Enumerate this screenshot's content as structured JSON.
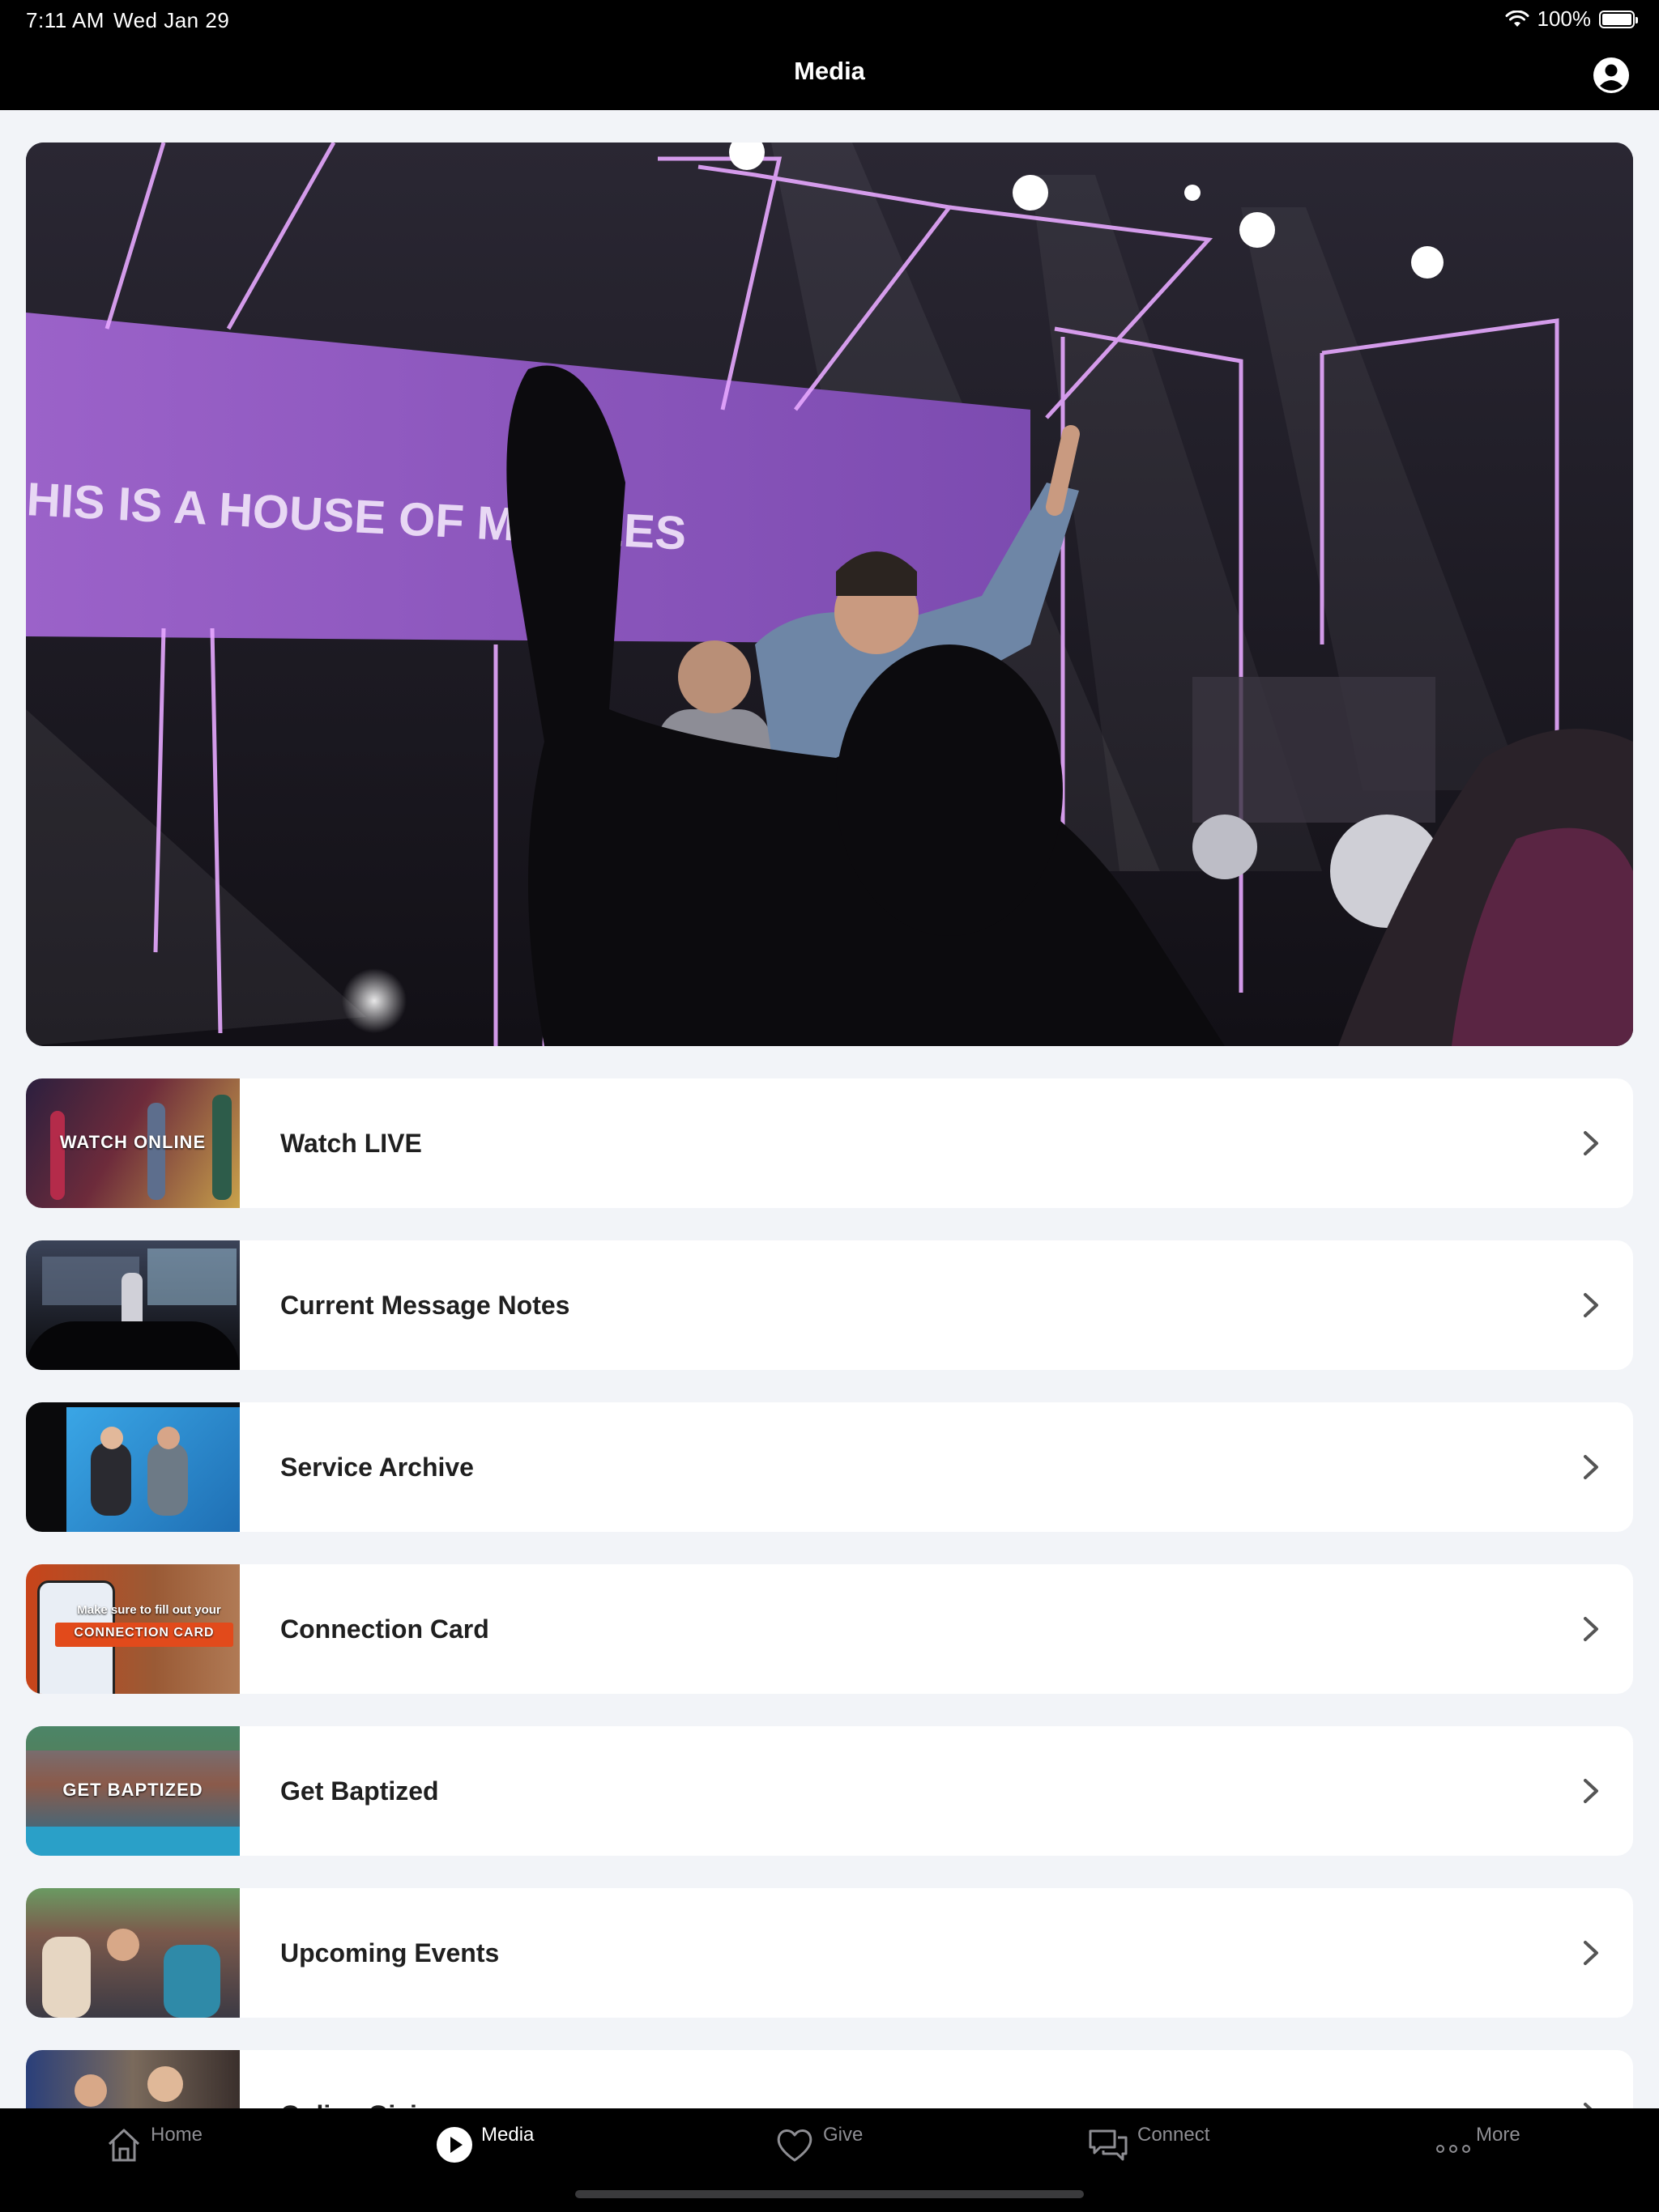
{
  "status": {
    "time": "7:11 AM",
    "date": "Wed Jan 29",
    "battery": "100%"
  },
  "nav": {
    "title": "Media"
  },
  "hero": {
    "screen_text": "HIS IS A HOUSE OF M ACLES"
  },
  "list": [
    {
      "label": "Watch LIVE",
      "thumb_text": "WATCH ONLINE"
    },
    {
      "label": "Current Message Notes",
      "thumb_text": ""
    },
    {
      "label": "Service Archive",
      "thumb_text": ""
    },
    {
      "label": "Connection Card",
      "thumb_text": "Make sure to fill out your",
      "thumb_text2": "CONNECTION CARD"
    },
    {
      "label": "Get Baptized",
      "thumb_text": "GET BAPTIZED"
    },
    {
      "label": "Upcoming Events",
      "thumb_text": ""
    },
    {
      "label": "Online Giving",
      "thumb_text": ""
    }
  ],
  "tabs": [
    {
      "label": "Home",
      "icon": "home-icon"
    },
    {
      "label": "Media",
      "icon": "play-circle-icon"
    },
    {
      "label": "Give",
      "icon": "heart-icon"
    },
    {
      "label": "Connect",
      "icon": "chat-bubbles-icon"
    },
    {
      "label": "More",
      "icon": "more-dots-icon"
    }
  ],
  "colors": {
    "tab_active": "#ffffff",
    "tab_inactive": "#8e8e93",
    "background": "#f2f4f8",
    "accent_purple": "#8a4fc4",
    "connection_orange": "#e24a1b"
  }
}
